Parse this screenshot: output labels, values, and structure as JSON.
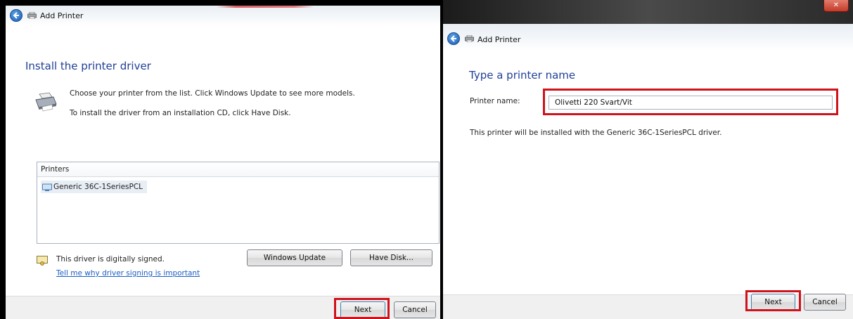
{
  "left_dialog": {
    "window_title": "Add Printer",
    "heading": "Install the printer driver",
    "instruction_1": "Choose your printer from the list. Click Windows Update to see more models.",
    "instruction_2": "To install the driver from an installation CD, click Have Disk.",
    "list_header": "Printers",
    "printers": [
      "Generic 36C-1SeriesPCL"
    ],
    "signed_text": "This driver is digitally signed.",
    "signing_link": "Tell me why driver signing is important",
    "windows_update_label": "Windows Update",
    "have_disk_label": "Have Disk...",
    "next_label": "Next",
    "cancel_label": "Cancel"
  },
  "right_dialog": {
    "window_title": "Add Printer",
    "heading": "Type a printer name",
    "field_label": "Printer name:",
    "printer_name_value": "Olivetti 220 Svart/Vit",
    "info_text": "This printer will be installed with the Generic 36C-1SeriesPCL driver.",
    "next_label": "Next",
    "cancel_label": "Cancel"
  },
  "colors": {
    "highlight": "#d0121b",
    "heading": "#1e3f97",
    "link": "#1a5ec4"
  }
}
